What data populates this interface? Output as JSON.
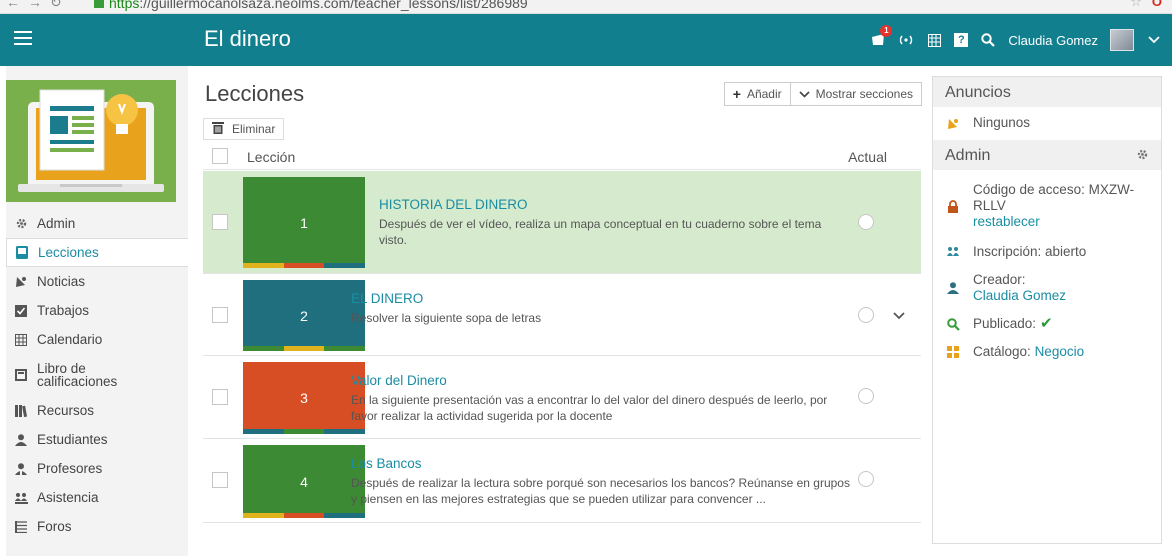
{
  "browser": {
    "url_scheme": "https",
    "url_rest": "://guillermocanolsaza.neolms.com/teacher_lessons/list/286989"
  },
  "header": {
    "course_title": "El dinero",
    "user_name": "Claudia Gomez",
    "notification_count": "1",
    "help_label": "?"
  },
  "sidebar": {
    "items": [
      {
        "label": "Admin",
        "icon": "gear-icon"
      },
      {
        "label": "Lecciones",
        "icon": "lessons-icon",
        "active": true
      },
      {
        "label": "Noticias",
        "icon": "megaphone-icon"
      },
      {
        "label": "Trabajos",
        "icon": "checkbox-icon"
      },
      {
        "label": "Calendario",
        "icon": "calendar-icon"
      },
      {
        "label": "Libro de calificaciones",
        "icon": "gradebook-icon"
      },
      {
        "label": "Recursos",
        "icon": "books-icon"
      },
      {
        "label": "Estudiantes",
        "icon": "person-icon"
      },
      {
        "label": "Profesores",
        "icon": "teacher-icon"
      },
      {
        "label": "Asistencia",
        "icon": "attendance-icon"
      },
      {
        "label": "Foros",
        "icon": "forums-icon"
      }
    ]
  },
  "main": {
    "title": "Lecciones",
    "add_label": "Añadir",
    "show_sections_label": "Mostrar secciones",
    "delete_label": "Eliminar",
    "col_lesson": "Lección",
    "col_current": "Actual",
    "lessons": [
      {
        "number": "1",
        "title": "HISTORIA DEL DINERO",
        "desc": "Después de ver el vídeo, realiza un mapa conceptual en tu cuaderno sobre el tema visto.",
        "color": "#3d8a35"
      },
      {
        "number": "2",
        "title": "EL DINERO",
        "desc": "Resolver la siguiente sopa de letras",
        "color": "#1f6f7e"
      },
      {
        "number": "3",
        "title": "Valor del Dinero",
        "desc": "En la siguiente presentación vas a encontrar lo del valor del dinero después de leerlo, por favor realizar la actividad sugerida por la docente",
        "color": "#d84e24"
      },
      {
        "number": "4",
        "title": "Los Bancos",
        "desc": "Después de realizar la lectura sobre porqué son necesarios los bancos? Reúnanse en grupos y piensen en las mejores estrategias que se pueden utilizar para convencer ...",
        "color": "#3d8a35"
      }
    ]
  },
  "announcements": {
    "title": "Anuncios",
    "none_label": "Ningunos"
  },
  "admin_panel": {
    "title": "Admin",
    "access_code_label": "Código de acceso: MXZW-RLLV",
    "reset_label": "restablecer",
    "enrollment_label": "Inscripción: abierto",
    "creator_label": "Creador:",
    "creator_name": "Claudia Gomez",
    "published_label": "Publicado:",
    "catalog_label": "Catálogo:",
    "catalog_value": "Negocio"
  }
}
